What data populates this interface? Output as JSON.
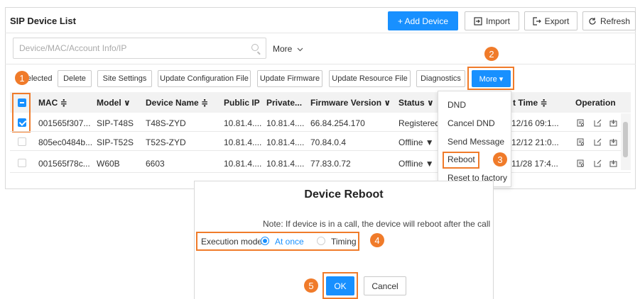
{
  "panel": {
    "title": "SIP Device List",
    "add_label": "+ Add Device",
    "import_label": "Import",
    "export_label": "Export",
    "refresh_label": "Refresh"
  },
  "search": {
    "placeholder": "Device/MAC/Account Info/IP",
    "more_label": "More"
  },
  "toolbar": {
    "selected_label": "elected",
    "delete_label": "Delete",
    "site_settings_label": "Site Settings",
    "update_config_label": "Update Configuration File",
    "update_firmware_label": "Update Firmware",
    "update_resource_label": "Update Resource File",
    "diagnostics_label": "Diagnostics",
    "more_label": "More ▾"
  },
  "table": {
    "headers": {
      "mac": "MAC ≑",
      "model": "Model ∨",
      "device_name": "Device Name ≑",
      "public_ip": "Public IP",
      "private_ip": "Private...",
      "firmware": "Firmware Version ∨",
      "status": "Status ∨",
      "time": "t Time ≑",
      "operation": "Operation"
    },
    "rows": [
      {
        "mac": "001565f307...",
        "model": "SIP-T48S",
        "name": "T48S-ZYD",
        "public_ip": "10.81.4....",
        "private_ip": "10.81.4....",
        "firmware": "66.84.254.170",
        "status": "Registered",
        "time": "12/16 09:1..."
      },
      {
        "mac": "805ec0484b...",
        "model": "SIP-T52S",
        "name": "T52S-ZYD",
        "public_ip": "10.81.4....",
        "private_ip": "10.81.4....",
        "firmware": "70.84.0.4",
        "status": "Offline ▼",
        "time": "12/12 21:0..."
      },
      {
        "mac": "001565f78c...",
        "model": "W60B",
        "name": "6603",
        "public_ip": "10.81.4....",
        "private_ip": "10.81.4....",
        "firmware": "77.83.0.72",
        "status": "Offline ▼",
        "time": "11/28 17:4..."
      }
    ]
  },
  "menu": {
    "items": [
      "DND",
      "Cancel DND",
      "Send Message",
      "Reboot",
      "Reset to factory"
    ]
  },
  "dialog": {
    "title": "Device Reboot",
    "note": "Note: If device is in a call, the device will reboot after the call",
    "mode_label": "Execution mode",
    "at_once_label": "At once",
    "timing_label": "Timing",
    "ok_label": "OK",
    "cancel_label": "Cancel"
  },
  "steps": [
    "1",
    "2",
    "3",
    "4",
    "5"
  ],
  "colors": {
    "accent": "#1890ff",
    "callout": "#f07b2a"
  },
  "icons": [
    "import-icon",
    "export-icon",
    "refresh-icon",
    "search-icon",
    "chevron-down-icon",
    "detail-icon",
    "edit-icon",
    "push-icon"
  ]
}
